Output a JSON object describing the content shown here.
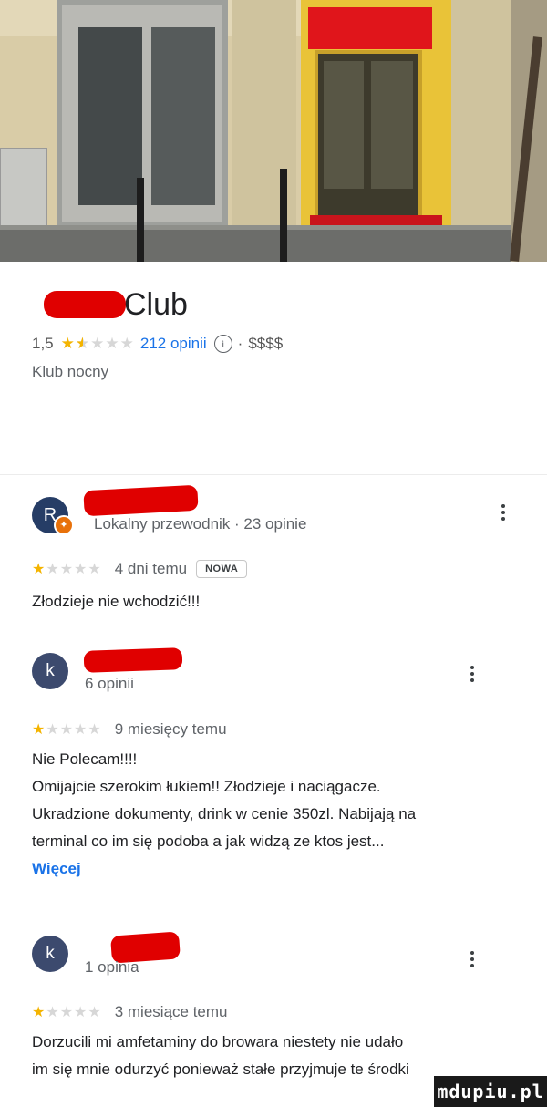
{
  "place": {
    "name_suffix": "Club",
    "rating": "1,5",
    "stars": "★★★★★",
    "review_count": "212 opinii",
    "info_symbol": "i",
    "price_sep": "·",
    "price_level": "$$$$",
    "category": "Klub nocny"
  },
  "reviews": [
    {
      "avatar_letter": "R",
      "badge_letter": "✦",
      "meta": "Lokalny przewodnik · 23 opinie",
      "stars": "★★★★★",
      "rating": 1,
      "time": "4 dni temu",
      "new_badge": "NOWA",
      "text_lines": [
        "Złodzieje nie wchodzić!!!"
      ]
    },
    {
      "avatar_letter": "k",
      "meta": "6 opinii",
      "stars": "★★★★★",
      "rating": 1,
      "time": "9 miesięcy temu",
      "text_lines": [
        "Nie Polecam!!!!",
        "Omijajcie szerokim łukiem!! Złodzieje i naciągacze.",
        "Ukradzione dokumenty, drink w cenie 350zl. Nabijają na",
        "terminal co im się podoba a jak widzą ze ktos jest..."
      ],
      "more_label": "Więcej"
    },
    {
      "avatar_letter": "k",
      "meta": "1 opinia",
      "stars": "★★★★★",
      "rating": 1,
      "time": "3 miesiące temu",
      "text_lines": [
        "Dorzucili mi amfetaminy do browara niestety nie udało",
        "im się mnie odurzyć ponieważ stałe przyjmuje te środki"
      ]
    }
  ],
  "watermark": "mdupiu.pl",
  "colors": {
    "accent_link": "#1a73e8",
    "star_on": "#f4b400",
    "star_off": "#d7d7d7",
    "censor_red": "#e00000"
  }
}
